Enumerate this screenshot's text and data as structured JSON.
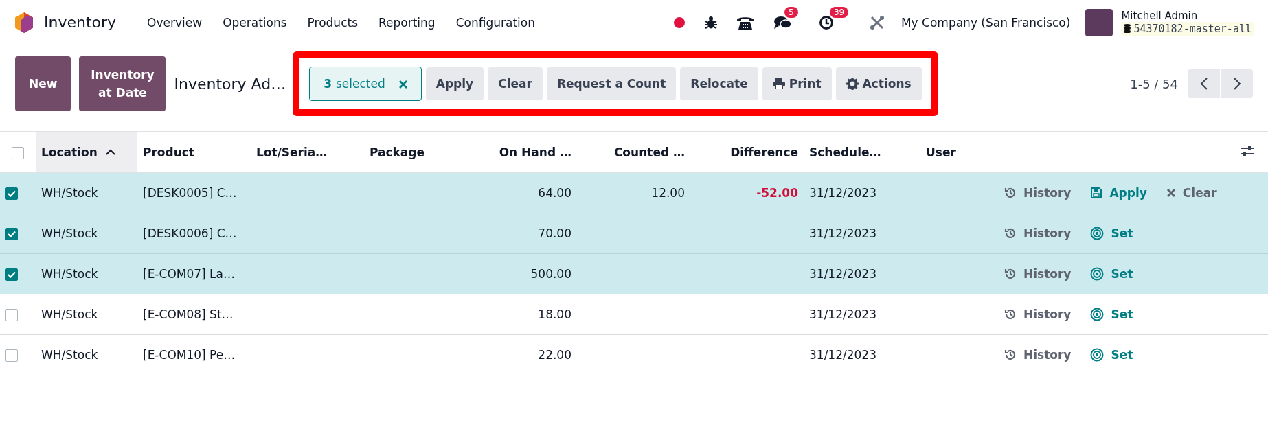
{
  "navbar": {
    "app_name": "Inventory",
    "menu": [
      "Overview",
      "Operations",
      "Products",
      "Reporting",
      "Configuration"
    ],
    "chat_badge": "5",
    "activity_badge": "39",
    "company": "My Company (San Francisco)",
    "user_name": "Mitchell Admin",
    "database": "54370182-master-all"
  },
  "control_panel": {
    "buttons": [
      "New",
      "Inventory at Date"
    ],
    "breadcrumb": "Inventory Ad…",
    "selection": {
      "count": "3",
      "label": "selected"
    },
    "actions": [
      {
        "label": "Apply",
        "kind": "plain"
      },
      {
        "label": "Clear",
        "kind": "plain"
      },
      {
        "label": "Request a Count",
        "kind": "plain"
      },
      {
        "label": "Relocate",
        "kind": "plain"
      },
      {
        "label": "Print",
        "kind": "print"
      },
      {
        "label": "Actions",
        "kind": "gear"
      }
    ],
    "pager": "1-5 / 54"
  },
  "table": {
    "all_selected": false,
    "columns": [
      {
        "label": "Location",
        "kind": "text",
        "sorted": true
      },
      {
        "label": "Product",
        "kind": "text",
        "sorted": false
      },
      {
        "label": "Lot/Seria…",
        "kind": "text",
        "sorted": false
      },
      {
        "label": "Package",
        "kind": "text",
        "sorted": false
      },
      {
        "label": "On Hand …",
        "kind": "number",
        "sorted": false
      },
      {
        "label": "Counted …",
        "kind": "number",
        "sorted": false
      },
      {
        "label": "Difference",
        "kind": "difference",
        "sorted": false
      },
      {
        "label": "Schedule…",
        "kind": "text",
        "sorted": false
      },
      {
        "label": "User",
        "kind": "text",
        "sorted": false
      }
    ],
    "rows": [
      {
        "selected": true,
        "cells": [
          "WH/Stock",
          "[DESK0005] C…",
          "",
          "",
          "64.00",
          "12.00",
          "-52.00",
          "31/12/2023",
          ""
        ],
        "actions": [
          {
            "label": "History",
            "kind": "history"
          },
          {
            "label": "Apply",
            "kind": "apply"
          },
          {
            "label": "Clear",
            "kind": "clear"
          }
        ]
      },
      {
        "selected": true,
        "cells": [
          "WH/Stock",
          "[DESK0006] C…",
          "",
          "",
          "70.00",
          "",
          "",
          "31/12/2023",
          ""
        ],
        "actions": [
          {
            "label": "History",
            "kind": "history"
          },
          {
            "label": "Set",
            "kind": "set"
          }
        ]
      },
      {
        "selected": true,
        "cells": [
          "WH/Stock",
          "[E-COM07] La…",
          "",
          "",
          "500.00",
          "",
          "",
          "31/12/2023",
          ""
        ],
        "actions": [
          {
            "label": "History",
            "kind": "history"
          },
          {
            "label": "Set",
            "kind": "set"
          }
        ]
      },
      {
        "selected": false,
        "cells": [
          "WH/Stock",
          "[E-COM08] St…",
          "",
          "",
          "18.00",
          "",
          "",
          "31/12/2023",
          ""
        ],
        "actions": [
          {
            "label": "History",
            "kind": "history"
          },
          {
            "label": "Set",
            "kind": "set"
          }
        ]
      },
      {
        "selected": false,
        "cells": [
          "WH/Stock",
          "[E-COM10] Pe…",
          "",
          "",
          "22.00",
          "",
          "",
          "31/12/2023",
          ""
        ],
        "actions": [
          {
            "label": "History",
            "kind": "history"
          },
          {
            "label": "Set",
            "kind": "set"
          }
        ]
      }
    ]
  }
}
